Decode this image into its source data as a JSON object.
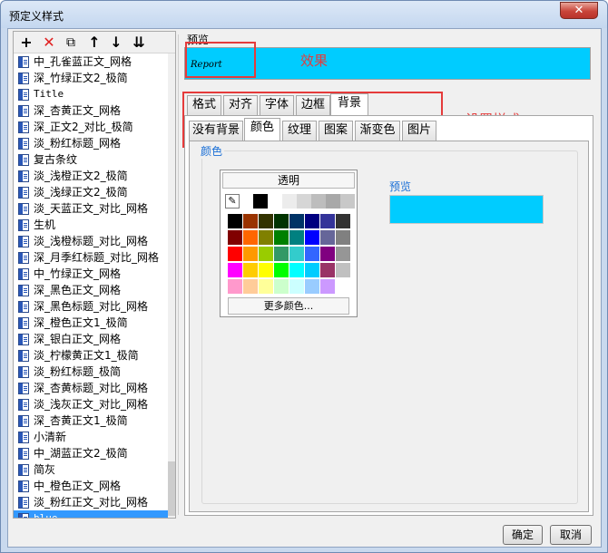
{
  "window": {
    "title": "预定义样式",
    "close_glyph": "✕"
  },
  "toolbar": {
    "add": "+",
    "delete": "✕",
    "copy": "⧉",
    "up": "↑",
    "down": "↓",
    "import": "⇊"
  },
  "style_list": [
    {
      "label": "中_孔雀蓝正文_网格",
      "mono": false
    },
    {
      "label": "深_竹绿正文2_极简",
      "mono": false
    },
    {
      "label": "Title",
      "mono": true
    },
    {
      "label": "深_杏黄正文_网格",
      "mono": false
    },
    {
      "label": "深_正文2_对比_极简",
      "mono": false
    },
    {
      "label": "淡_粉红标题_网格",
      "mono": false
    },
    {
      "label": "复古条纹",
      "mono": false
    },
    {
      "label": "淡_浅橙正文2_极简",
      "mono": false
    },
    {
      "label": "淡_浅绿正文2_极简",
      "mono": false
    },
    {
      "label": "淡_天蓝正文_对比_网格",
      "mono": false
    },
    {
      "label": "生机",
      "mono": false
    },
    {
      "label": "淡_浅橙标题_对比_网格",
      "mono": false
    },
    {
      "label": "深_月季红标题_对比_网格",
      "mono": false
    },
    {
      "label": "中_竹绿正文_网格",
      "mono": false
    },
    {
      "label": "深_黑色正文_网格",
      "mono": false
    },
    {
      "label": "深_黑色标题_对比_网格",
      "mono": false
    },
    {
      "label": "深_橙色正文1_极简",
      "mono": false
    },
    {
      "label": "深_银白正文_网格",
      "mono": false
    },
    {
      "label": "淡_柠檬黄正文1_极简",
      "mono": false
    },
    {
      "label": "淡_粉红标题_极简",
      "mono": false
    },
    {
      "label": "深_杏黄标题_对比_网格",
      "mono": false
    },
    {
      "label": "淡_浅灰正文_对比_网格",
      "mono": false
    },
    {
      "label": "深_杏黄正文1_极简",
      "mono": false
    },
    {
      "label": "小清新",
      "mono": false
    },
    {
      "label": "中_湖蓝正文2_极简",
      "mono": false
    },
    {
      "label": "简灰",
      "mono": false
    },
    {
      "label": "中_橙色正文_网格",
      "mono": false
    },
    {
      "label": "淡_粉红正文_对比_网格",
      "mono": false
    },
    {
      "label": "blue",
      "mono": true,
      "selected": true
    }
  ],
  "preview": {
    "label": "预览",
    "sample_text": "Report",
    "color": "#00ccff"
  },
  "annotations": {
    "effect": "效果",
    "set_style": "设置样式",
    "color": "#e53b3b"
  },
  "main_tabs": [
    "格式",
    "对齐",
    "字体",
    "边框",
    "背景"
  ],
  "main_tab_active": "背景",
  "sub_tabs": [
    "没有背景",
    "颜色",
    "纹理",
    "图案",
    "渐变色",
    "图片"
  ],
  "sub_tab_active": "颜色",
  "color_panel": {
    "group_label": "颜色",
    "transparent_label": "透明",
    "more_colors_label": "更多颜色...",
    "inner_preview_label": "预览",
    "selected_color": "#00ccff",
    "top_row": [
      "#000000",
      "#ffffff",
      "#ececec",
      "#d6d6d6",
      "#bdbdbd",
      "#a8a8a8",
      "#c8c8c8"
    ],
    "grid": [
      [
        "#000000",
        "#993300",
        "#333300",
        "#003300",
        "#003366",
        "#000080",
        "#333399",
        "#333333"
      ],
      [
        "#800000",
        "#ff6600",
        "#808000",
        "#008000",
        "#008080",
        "#0000ff",
        "#666699",
        "#808080"
      ],
      [
        "#ff0000",
        "#ff9900",
        "#99cc00",
        "#339966",
        "#33cccc",
        "#3366ff",
        "#800080",
        "#969696"
      ],
      [
        "#ff00ff",
        "#ffcc00",
        "#ffff00",
        "#00ff00",
        "#00ffff",
        "#00ccff",
        "#993366",
        "#c0c0c0"
      ],
      [
        "#ff99cc",
        "#ffcc99",
        "#ffff99",
        "#ccffcc",
        "#ccffff",
        "#99ccff",
        "#cc99ff",
        "#ffffff"
      ]
    ]
  },
  "footer": {
    "ok": "确定",
    "cancel": "取消"
  }
}
